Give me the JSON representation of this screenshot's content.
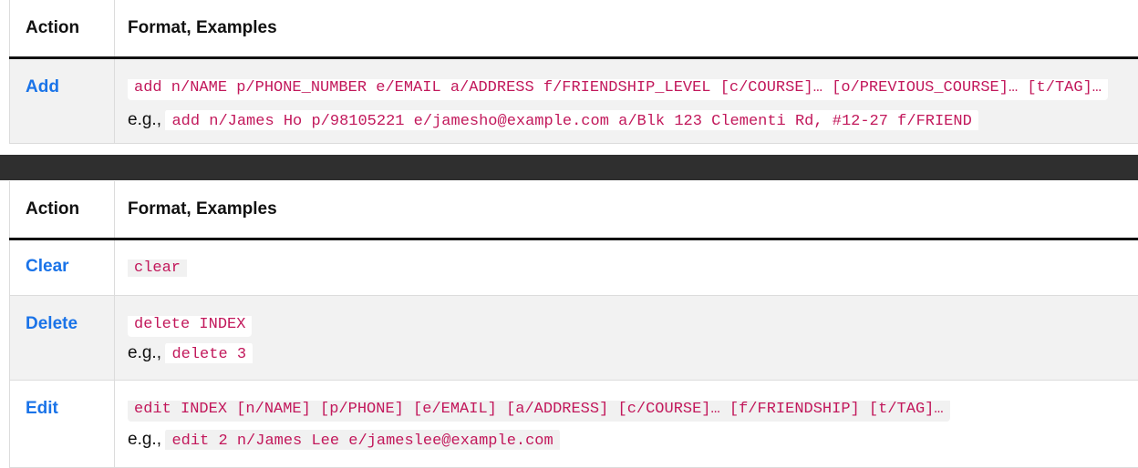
{
  "table1": {
    "headers": {
      "action": "Action",
      "format": "Format, Examples"
    },
    "rows": [
      {
        "action": "Add",
        "format": "add n/NAME p/PHONE_NUMBER e/EMAIL a/ADDRESS f/FRIENDSHIP_LEVEL [c/COURSE]… [o/PREVIOUS_COURSE]… [t/TAG]…",
        "eg_prefix": "e.g.,",
        "example": "add n/James Ho p/98105221 e/jamesho@example.com a/Blk 123 Clementi Rd, #12-27 f/FRIEND"
      }
    ]
  },
  "table2": {
    "headers": {
      "action": "Action",
      "format": "Format, Examples"
    },
    "rows": [
      {
        "action": "Clear",
        "format": "clear"
      },
      {
        "action": "Delete",
        "format": "delete INDEX",
        "eg_prefix": "e.g.,",
        "example": "delete 3"
      },
      {
        "action": "Edit",
        "format": "edit INDEX [n/NAME] [p/PHONE] [e/EMAIL] [a/ADDRESS] [c/COURSE]… [f/FRIENDSHIP] [t/TAG]…",
        "eg_prefix": "e.g.,",
        "example": "edit 2 n/James Lee e/jameslee@example.com"
      }
    ]
  },
  "colors": {
    "link": "#1a73e8",
    "code": "#c2185b",
    "divider": "#2f2f2f",
    "alt_row": "#f2f2f2"
  }
}
